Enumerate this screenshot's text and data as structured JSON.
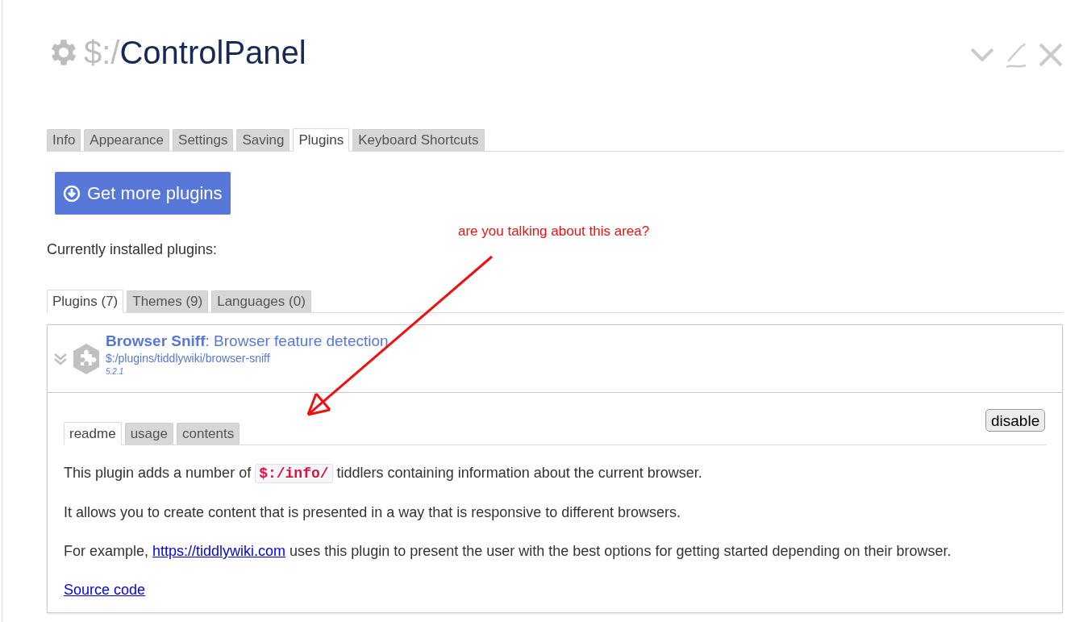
{
  "title": {
    "prefix": "$:/",
    "name": "ControlPanel"
  },
  "tabs": [
    {
      "label": "Info",
      "selected": false
    },
    {
      "label": "Appearance",
      "selected": false
    },
    {
      "label": "Settings",
      "selected": false
    },
    {
      "label": "Saving",
      "selected": false
    },
    {
      "label": "Plugins",
      "selected": true
    },
    {
      "label": "Keyboard Shortcuts",
      "selected": false
    }
  ],
  "get_more_button": "Get more plugins",
  "installed_label": "Currently installed plugins:",
  "plugin_tabs": [
    {
      "label": "Plugins (7)",
      "selected": true
    },
    {
      "label": "Themes (9)",
      "selected": false
    },
    {
      "label": "Languages (0)",
      "selected": false
    }
  ],
  "plugin": {
    "name": "Browser Sniff",
    "description": ": Browser feature detection",
    "path": "$:/plugins/tiddlywiki/browser-sniff",
    "version": "5.2.1",
    "expanded": true,
    "disable_button": "disable",
    "tabs": [
      {
        "label": "readme",
        "selected": true
      },
      {
        "label": "usage",
        "selected": false
      },
      {
        "label": "contents",
        "selected": false
      }
    ],
    "paragraphs": [
      [
        {
          "kind": "text",
          "text": "This plugin adds a number of "
        },
        {
          "kind": "code",
          "text": "$:/info/"
        },
        {
          "kind": "text",
          "text": " tiddlers containing information about the current browser."
        }
      ],
      [
        {
          "kind": "text",
          "text": "It allows you to create content that is presented in a way that is responsive to different browsers."
        }
      ],
      [
        {
          "kind": "text",
          "text": "For example, "
        },
        {
          "kind": "link",
          "text": "https://tiddlywiki.com"
        },
        {
          "kind": "text",
          "text": " uses this plugin to present the user with the best options for getting started depending on their browser."
        }
      ],
      [
        {
          "kind": "link",
          "text": "Source code"
        }
      ]
    ]
  },
  "annotation": "are you talking about this area?"
}
